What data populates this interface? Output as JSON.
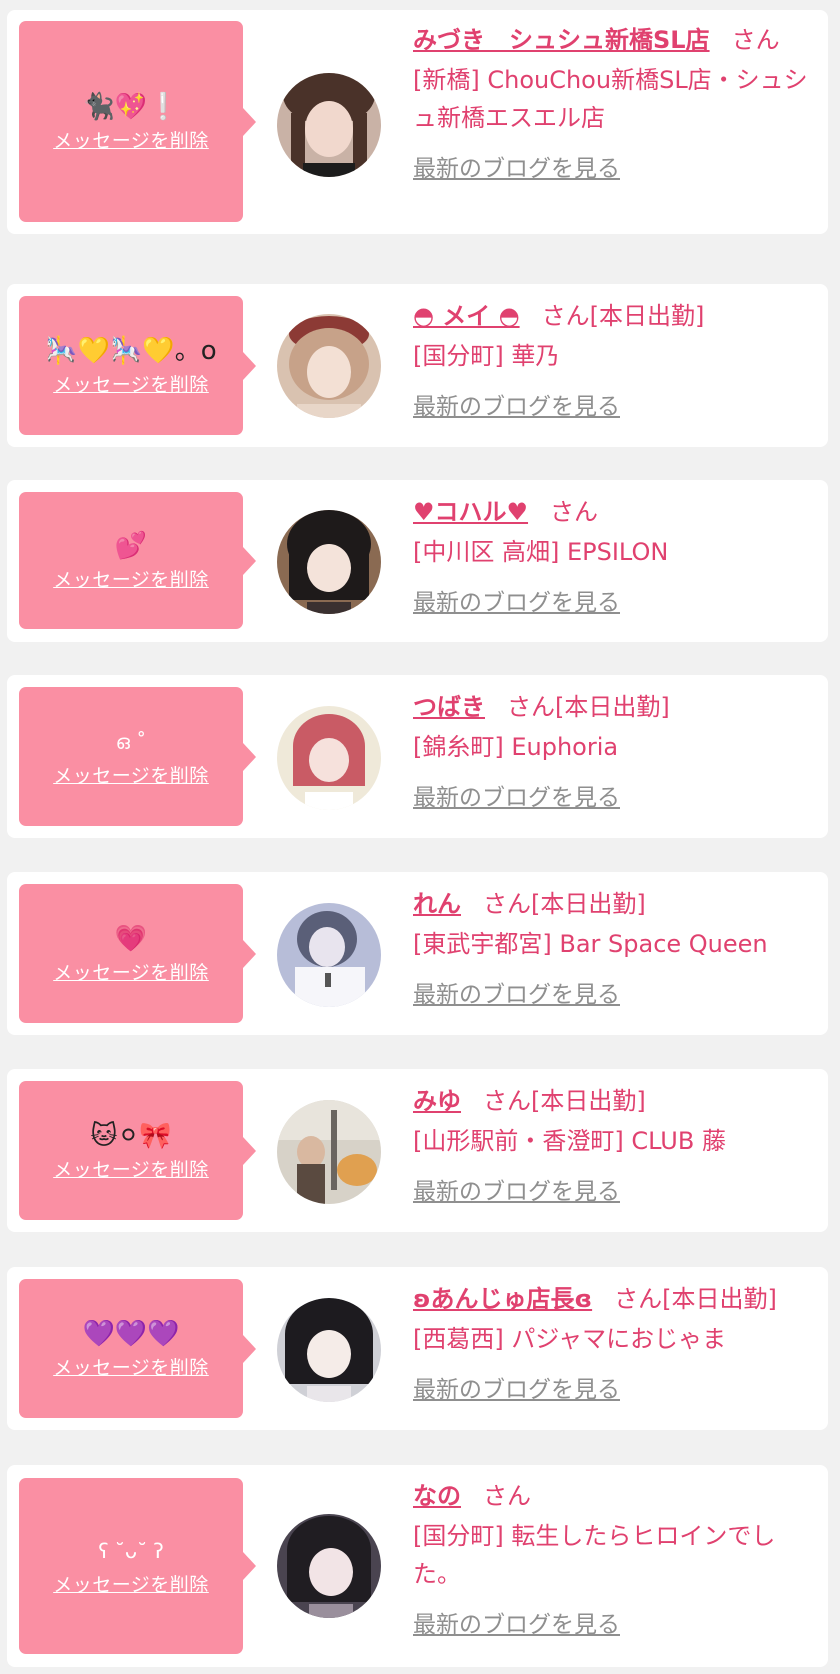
{
  "delete_label": "メッセージを削除",
  "blog_label": "最新のブログを見る",
  "san_label": "さん",
  "accent_color": "#e0416f",
  "bubble_color": "#fa8fa3",
  "messages": [
    {
      "emoji": "🐈‍⬛💖❕",
      "name": "みづき　シュシュ新橋SL店",
      "suffix": "さん",
      "shop": "[新橋] ChouChou新橋SL店・シュシュ新橋エスエル店"
    },
    {
      "emoji": "🎠💛🎠💛。o",
      "name": "◓ メイ ◓",
      "suffix": "さん[本日出勤]",
      "shop": "[国分町] 華乃"
    },
    {
      "emoji": "💕",
      "name": "♥コハル♥",
      "suffix": "さん",
      "shop": "[中川区 高畑] EPSILON"
    },
    {
      "emoji": "ഒ ˚",
      "name": "つばき",
      "suffix": "さん[本日出勤]",
      "shop": "[錦糸町] Euphoria"
    },
    {
      "emoji": "💗",
      "name": "れん",
      "suffix": "さん[本日出勤]",
      "shop": "[東武宇都宮] Bar Space Queen"
    },
    {
      "emoji": "🐱⚪︎🎀",
      "name": "みゆ",
      "suffix": "さん[本日出勤]",
      "shop": "[山形駅前・香澄町] CLUB 藤"
    },
    {
      "emoji": "💜💜💜",
      "name": "ʚあんじゅ店長ɞ",
      "suffix": "さん[本日出勤]",
      "shop": "[西葛西] パジャマにおじゃま"
    },
    {
      "emoji": "ʕ ˘ᴗ˘ ʔ",
      "name": "なの",
      "suffix": "さん",
      "shop": "[国分町] 転生したらヒロインでした。"
    }
  ]
}
